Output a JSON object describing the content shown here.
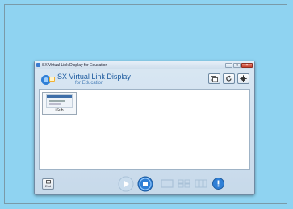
{
  "window": {
    "title": "SX Virtual Link Display for Education"
  },
  "header": {
    "brand_name": "SX Virtual Link Display",
    "brand_sub": "for Education"
  },
  "thumbnails": [
    {
      "label": "iSub"
    }
  ],
  "bottom": {
    "end_label": "End"
  },
  "colors": {
    "background": "#8fd3f1",
    "accent": "#2f7fd6",
    "brand": "#1c5a9e"
  }
}
